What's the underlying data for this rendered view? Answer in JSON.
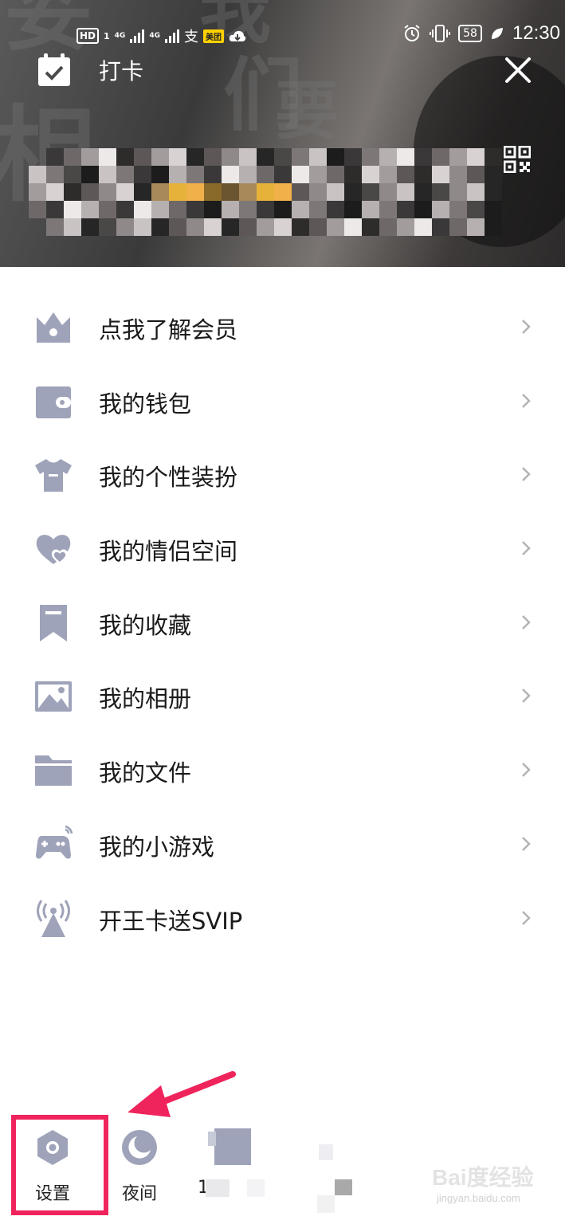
{
  "status_bar": {
    "hd": "HD",
    "sim1": "1",
    "net1": "4G",
    "net2": "4G",
    "alipay": "支",
    "meituan": "美团",
    "battery": "58",
    "time": "12:30"
  },
  "header": {
    "checkin_label": "打卡",
    "background_text": [
      "妥",
      "相",
      "我",
      "们",
      "要"
    ]
  },
  "menu": {
    "items": [
      {
        "label": "点我了解会员",
        "icon": "crown-icon"
      },
      {
        "label": "我的钱包",
        "icon": "wallet-icon"
      },
      {
        "label": "我的个性装扮",
        "icon": "tshirt-icon"
      },
      {
        "label": "我的情侣空间",
        "icon": "hearts-icon"
      },
      {
        "label": "我的收藏",
        "icon": "bookmark-icon"
      },
      {
        "label": "我的相册",
        "icon": "photo-icon"
      },
      {
        "label": "我的文件",
        "icon": "folder-icon"
      },
      {
        "label": "我的小游戏",
        "icon": "gamepad-icon"
      },
      {
        "label": "开王卡送SVIP",
        "icon": "broadcast-tower-icon"
      }
    ]
  },
  "bottom_bar": {
    "settings_label": "设置",
    "night_label": "夜间",
    "third_label_partial": "1"
  },
  "watermark": {
    "main": "Bai度经验",
    "sub": "jingyan.baidu.com"
  },
  "colors": {
    "icon_gray": "#9ea3b9",
    "highlight": "#f0245c",
    "text": "#1a1a1a"
  }
}
